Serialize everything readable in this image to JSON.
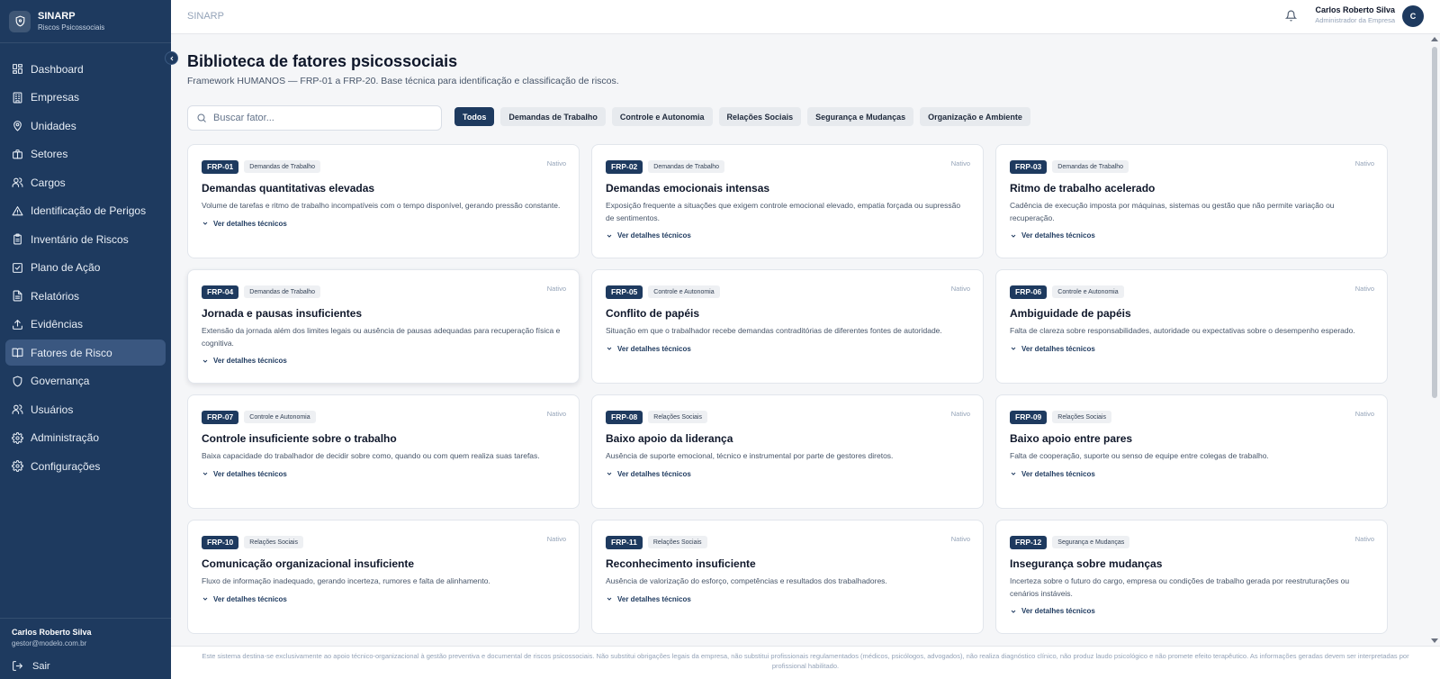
{
  "brand": {
    "name": "SINARP",
    "subtitle": "Riscos Psicossociais"
  },
  "sidebar": {
    "items": [
      {
        "label": "Dashboard",
        "icon": "dashboard-icon",
        "active": false
      },
      {
        "label": "Empresas",
        "icon": "building-icon",
        "active": false
      },
      {
        "label": "Unidades",
        "icon": "map-pin-icon",
        "active": false
      },
      {
        "label": "Setores",
        "icon": "briefcase-icon",
        "active": false
      },
      {
        "label": "Cargos",
        "icon": "users-icon",
        "active": false
      },
      {
        "label": "Identificação de Perigos",
        "icon": "warning-icon",
        "active": false
      },
      {
        "label": "Inventário de Riscos",
        "icon": "clipboard-icon",
        "active": false
      },
      {
        "label": "Plano de Ação",
        "icon": "checkbox-icon",
        "active": false
      },
      {
        "label": "Relatórios",
        "icon": "file-icon",
        "active": false
      },
      {
        "label": "Evidências",
        "icon": "upload-icon",
        "active": false
      },
      {
        "label": "Fatores de Risco",
        "icon": "book-icon",
        "active": true
      },
      {
        "label": "Governança",
        "icon": "shield-icon",
        "active": false
      },
      {
        "label": "Usuários",
        "icon": "users-icon",
        "active": false
      },
      {
        "label": "Administração",
        "icon": "gear-icon",
        "active": false
      },
      {
        "label": "Configurações",
        "icon": "gear-icon",
        "active": false
      }
    ],
    "user": {
      "name": "Carlos Roberto Silva",
      "email": "gestor@modelo.com.br"
    },
    "logout_label": "Sair"
  },
  "header": {
    "breadcrumb": "SINARP",
    "user_name": "Carlos Roberto Silva",
    "user_role": "Administrador da Empresa",
    "avatar_initial": "C"
  },
  "page": {
    "title": "Biblioteca de fatores psicossociais",
    "subtitle": "Framework HUMANOS — FRP-01 a FRP-20. Base técnica para identificação e classificação de riscos."
  },
  "search": {
    "placeholder": "Buscar fator...",
    "value": ""
  },
  "filters": [
    {
      "label": "Todos",
      "active": true
    },
    {
      "label": "Demandas de Trabalho",
      "active": false
    },
    {
      "label": "Controle e Autonomia",
      "active": false
    },
    {
      "label": "Relações Sociais",
      "active": false
    },
    {
      "label": "Segurança e Mudanças",
      "active": false
    },
    {
      "label": "Organização e Ambiente",
      "active": false
    }
  ],
  "card_common": {
    "native_label": "Nativo",
    "details_label": "Ver detalhes técnicos"
  },
  "factors": [
    {
      "code": "FRP-01",
      "category": "Demandas de Trabalho",
      "title": "Demandas quantitativas elevadas",
      "description": "Volume de tarefas e ritmo de trabalho incompatíveis com o tempo disponível, gerando pressão constante."
    },
    {
      "code": "FRP-02",
      "category": "Demandas de Trabalho",
      "title": "Demandas emocionais intensas",
      "description": "Exposição frequente a situações que exigem controle emocional elevado, empatia forçada ou supressão de sentimentos."
    },
    {
      "code": "FRP-03",
      "category": "Demandas de Trabalho",
      "title": "Ritmo de trabalho acelerado",
      "description": "Cadência de execução imposta por máquinas, sistemas ou gestão que não permite variação ou recuperação."
    },
    {
      "code": "FRP-04",
      "category": "Demandas de Trabalho",
      "title": "Jornada e pausas insuficientes",
      "description": "Extensão da jornada além dos limites legais ou ausência de pausas adequadas para recuperação física e cognitiva."
    },
    {
      "code": "FRP-05",
      "category": "Controle e Autonomia",
      "title": "Conflito de papéis",
      "description": "Situação em que o trabalhador recebe demandas contraditórias de diferentes fontes de autoridade."
    },
    {
      "code": "FRP-06",
      "category": "Controle e Autonomia",
      "title": "Ambiguidade de papéis",
      "description": "Falta de clareza sobre responsabilidades, autoridade ou expectativas sobre o desempenho esperado."
    },
    {
      "code": "FRP-07",
      "category": "Controle e Autonomia",
      "title": "Controle insuficiente sobre o trabalho",
      "description": "Baixa capacidade do trabalhador de decidir sobre como, quando ou com quem realiza suas tarefas."
    },
    {
      "code": "FRP-08",
      "category": "Relações Sociais",
      "title": "Baixo apoio da liderança",
      "description": "Ausência de suporte emocional, técnico e instrumental por parte de gestores diretos."
    },
    {
      "code": "FRP-09",
      "category": "Relações Sociais",
      "title": "Baixo apoio entre pares",
      "description": "Falta de cooperação, suporte ou senso de equipe entre colegas de trabalho."
    },
    {
      "code": "FRP-10",
      "category": "Relações Sociais",
      "title": "Comunicação organizacional insuficiente",
      "description": "Fluxo de informação inadequado, gerando incerteza, rumores e falta de alinhamento."
    },
    {
      "code": "FRP-11",
      "category": "Relações Sociais",
      "title": "Reconhecimento insuficiente",
      "description": "Ausência de valorização do esforço, competências e resultados dos trabalhadores."
    },
    {
      "code": "FRP-12",
      "category": "Segurança e Mudanças",
      "title": "Insegurança sobre mudanças",
      "description": "Incerteza sobre o futuro do cargo, empresa ou condições de trabalho gerada por reestruturações ou cenários instáveis."
    }
  ],
  "footer": {
    "text": "Este sistema destina-se exclusivamente ao apoio técnico-organizacional à gestão preventiva e documental de riscos psicossociais. Não substitui obrigações legais da empresa, não substitui profissionais regulamentados (médicos, psicólogos, advogados), não realiza diagnóstico clínico, não produz laudo psicológico e não promete efeito terapêutico. As informações geradas devem ser interpretadas por profissional habilitado."
  },
  "colors": {
    "primary": "#1e3a5f",
    "active_nav": "#3a5780",
    "background": "#f5f6f8"
  }
}
